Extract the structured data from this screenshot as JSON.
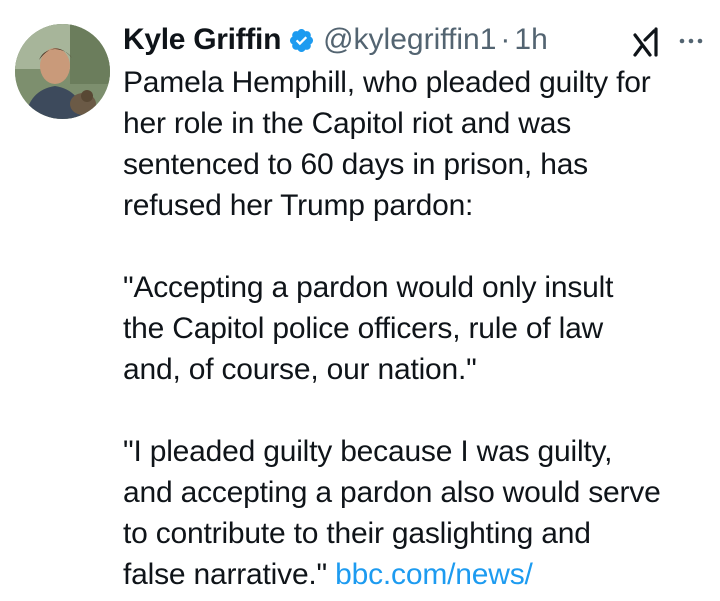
{
  "author": {
    "name": "Kyle Griffin",
    "handle": "@kylegriffin1",
    "separator": "·",
    "time": "1h",
    "verified": true,
    "verified_color": "#1d9bf0"
  },
  "icons": {
    "avatar": "profile-photo",
    "verified": "verified-badge-icon",
    "grok": "grok-icon",
    "more": "more-options-icon"
  },
  "tweet": {
    "paragraph1": [
      "Pamela Hemphill, who pleaded guilty for",
      "her role in the Capitol riot and was",
      "sentenced to 60 days in prison, has",
      "refused her Trump pardon:"
    ],
    "paragraph2": [
      "\"Accepting a pardon would only insult",
      "the Capitol police officers, rule of law",
      "and, of course, our nation.\""
    ],
    "paragraph3": [
      "\"I pleaded guilty because I was guilty,",
      "and accepting a pardon also would serve",
      "to contribute to their gaslighting and"
    ],
    "last_line_text": "false narrative.\" ",
    "link_text": "bbc.com/news/",
    "link_color": "#1d9bf0"
  }
}
